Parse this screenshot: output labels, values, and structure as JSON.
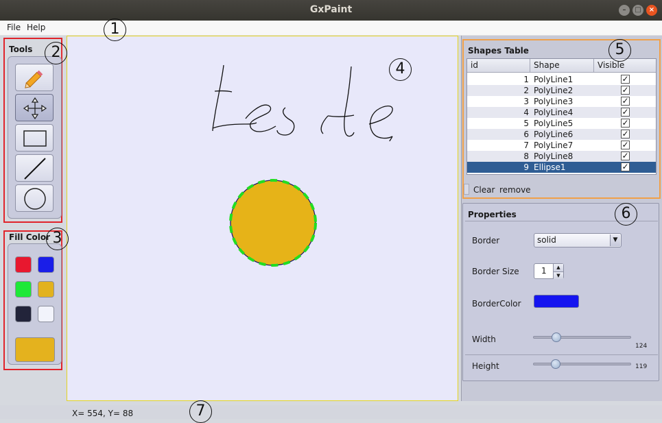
{
  "window": {
    "title": "GxPaint"
  },
  "menu": {
    "items": [
      "File",
      "Help"
    ]
  },
  "markers": [
    "1",
    "2",
    "3",
    "4",
    "5",
    "6",
    "7"
  ],
  "tools": {
    "title": "Tools",
    "items": [
      {
        "name": "pencil-tool",
        "icon": "pencil-icon"
      },
      {
        "name": "move-tool",
        "icon": "move-arrows-icon",
        "active": true
      },
      {
        "name": "rectangle-tool",
        "icon": "rectangle-icon"
      },
      {
        "name": "line-tool",
        "icon": "line-icon"
      },
      {
        "name": "ellipse-tool",
        "icon": "circle-icon"
      }
    ]
  },
  "fill_color": {
    "title": "Fill Color",
    "swatches": [
      "#e8182f",
      "#1a1ee8",
      "#1ee838",
      "#e2b21e",
      "#22243a",
      "#f2f3fb"
    ],
    "current": "#e4b21e"
  },
  "canvas": {
    "drawing_text": "teste",
    "ellipse": {
      "fill": "#e6b318",
      "stroke": "#1a1e6a",
      "selection_stroke": "#22dd22"
    },
    "background": "#e8e8fa"
  },
  "shapes_table": {
    "title": "Shapes Table",
    "columns": [
      "id",
      "Shape",
      "Visible"
    ],
    "rows": [
      {
        "id": "1",
        "shape": "PolyLine1",
        "visible": true
      },
      {
        "id": "2",
        "shape": "PolyLine2",
        "visible": true
      },
      {
        "id": "3",
        "shape": "PolyLine3",
        "visible": true
      },
      {
        "id": "4",
        "shape": "PolyLine4",
        "visible": true
      },
      {
        "id": "5",
        "shape": "PolyLine5",
        "visible": true
      },
      {
        "id": "6",
        "shape": "PolyLine6",
        "visible": true
      },
      {
        "id": "7",
        "shape": "PolyLine7",
        "visible": true
      },
      {
        "id": "8",
        "shape": "PolyLine8",
        "visible": true
      },
      {
        "id": "9",
        "shape": "Ellipse1",
        "visible": true,
        "selected": true
      }
    ],
    "buttons": {
      "clear": "Clear",
      "remove": "remove"
    }
  },
  "properties": {
    "title": "Properties",
    "border_label": "Border",
    "border_value": "solid",
    "border_size_label": "Border Size",
    "border_size_value": "1",
    "border_color_label": "BorderColor",
    "border_color": "#1414f0",
    "width_label": "Width",
    "width_value": "124",
    "height_label": "Height",
    "height_value": "119",
    "width_fraction": 0.24,
    "height_fraction": 0.23
  },
  "status": {
    "coords": "X= 554, Y= 88"
  }
}
